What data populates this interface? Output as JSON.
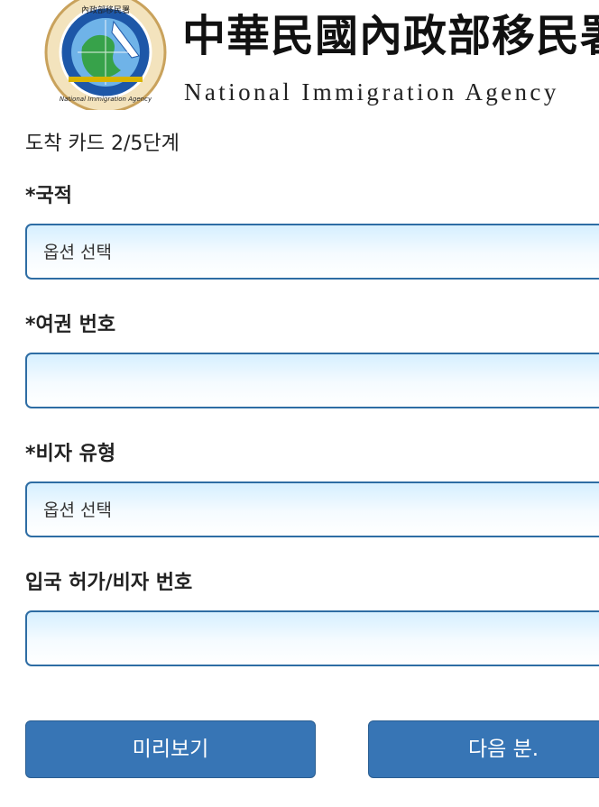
{
  "header": {
    "agency_name_zh": "中華民國內政部移民署",
    "agency_name_en": "National Immigration Agency",
    "logo": {
      "icon": "national-immigration-agency-emblem",
      "ring_text_top": "內政部移民署",
      "ring_text_bottom": "National Immigration Agency",
      "colors": {
        "ring": "#e9c98a",
        "inner_ring": "#1d57a8",
        "globe": "#37a24a",
        "sky": "#6fb3e8"
      }
    }
  },
  "form": {
    "step_text": "도착 카드 2/5단계",
    "fields": [
      {
        "label": "*국적",
        "value": "옵션 선택"
      },
      {
        "label": "*여권 번호",
        "value": ""
      },
      {
        "label": "*비자 유형",
        "value": "옵션 선택"
      },
      {
        "label": "입국 허가/비자 번호",
        "value": ""
      }
    ]
  },
  "buttons": {
    "preview": "미리보기",
    "next": "다음 분."
  },
  "colors": {
    "field_border": "#2e6da4",
    "field_gradient_top": "#d6efff",
    "button_bg": "#3775b5",
    "button_text": "#ffffff"
  }
}
